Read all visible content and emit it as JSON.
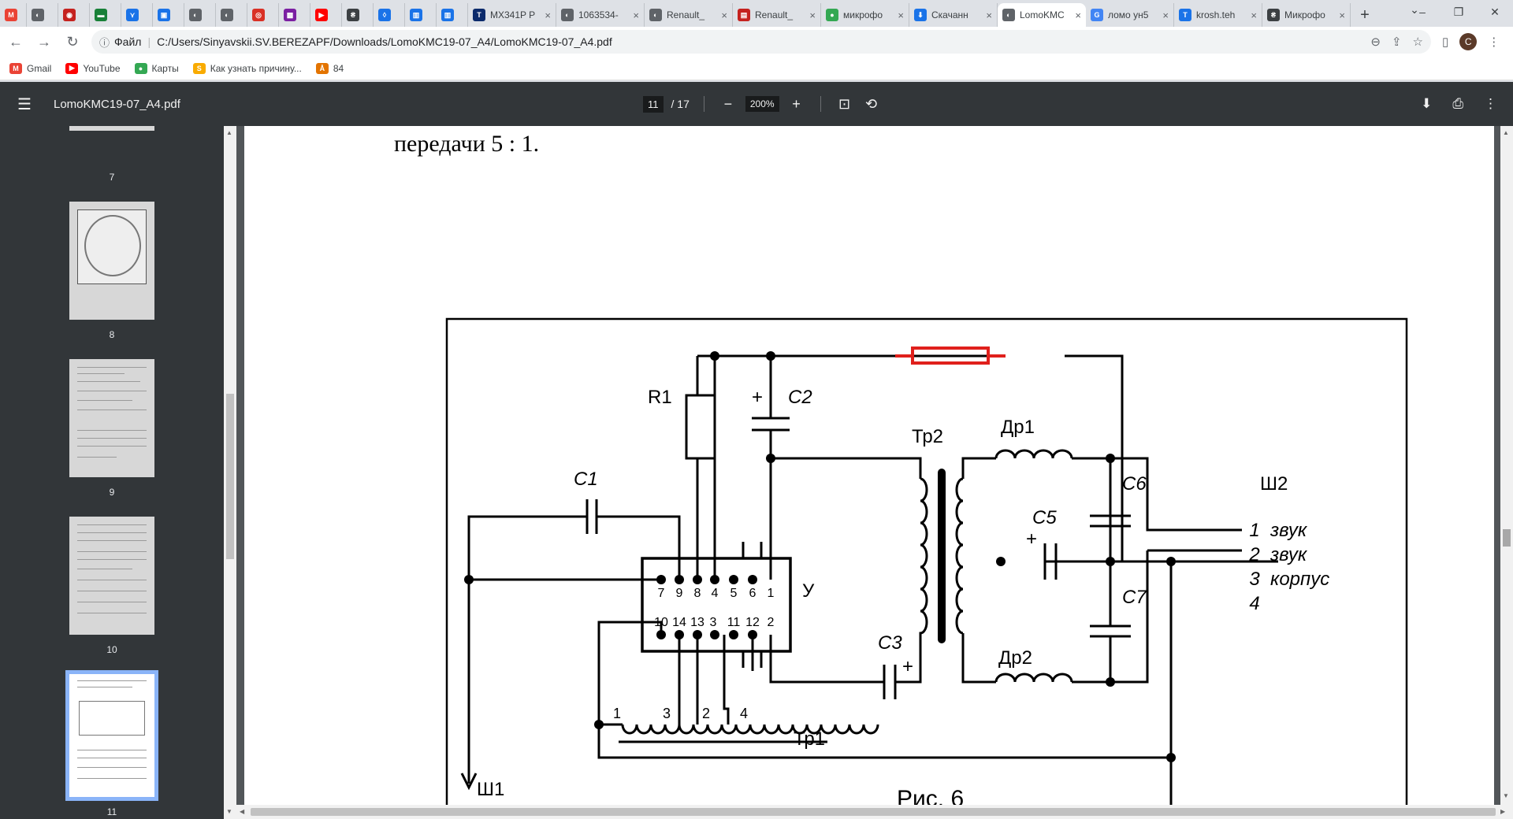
{
  "browser": {
    "tabs": [
      {
        "title": "",
        "color": "#ea4335",
        "glyph": "M"
      },
      {
        "title": "",
        "color": "#5f6368",
        "glyph": "◐"
      },
      {
        "title": "",
        "color": "#c5221f",
        "glyph": "◉"
      },
      {
        "title": "",
        "color": "#188038",
        "glyph": "▬"
      },
      {
        "title": "",
        "color": "#1a73e8",
        "glyph": "⋎"
      },
      {
        "title": "",
        "color": "#1a73e8",
        "glyph": "▣"
      },
      {
        "title": "",
        "color": "#5f6368",
        "glyph": "◐"
      },
      {
        "title": "",
        "color": "#5f6368",
        "glyph": "◐"
      },
      {
        "title": "",
        "color": "#d93025",
        "glyph": "◎"
      },
      {
        "title": "",
        "color": "#7b1fa2",
        "glyph": "▩"
      },
      {
        "title": "",
        "color": "#ff0000",
        "glyph": "▶"
      },
      {
        "title": "",
        "color": "#3c4043",
        "glyph": "₴"
      },
      {
        "title": "",
        "color": "#1a73e8",
        "glyph": "◊"
      },
      {
        "title": "",
        "color": "#1a73e8",
        "glyph": "▥"
      },
      {
        "title": "",
        "color": "#1a73e8",
        "glyph": "▥"
      },
      {
        "title": "MX341P P",
        "color": "#0b2a6b",
        "glyph": "T"
      },
      {
        "title": "1063534-",
        "color": "#5f6368",
        "glyph": "◐"
      },
      {
        "title": "Renault_",
        "color": "#5f6368",
        "glyph": "◐"
      },
      {
        "title": "Renault_",
        "color": "#c5221f",
        "glyph": "▤"
      },
      {
        "title": "микрофо",
        "color": "#34a853",
        "glyph": "●"
      },
      {
        "title": "Скачанн",
        "color": "#1a73e8",
        "glyph": "⬇"
      },
      {
        "title": "LomoKMC",
        "color": "#5f6368",
        "glyph": "◐",
        "active": true
      },
      {
        "title": "ломо ун5",
        "color": "#4285f4",
        "glyph": "G"
      },
      {
        "title": "krosh.teh",
        "color": "#1a73e8",
        "glyph": "T"
      },
      {
        "title": "Микрофо",
        "color": "#3c4043",
        "glyph": "₴"
      }
    ],
    "address": {
      "scheme_label": "Файл",
      "url": "C:/Users/Sinyavskii.SV.BEREZAPF/Downloads/LomoKMC19-07_A4/LomoKMC19-07_A4.pdf"
    },
    "avatar_letter": "С",
    "bookmarks": [
      {
        "label": "Gmail",
        "color": "#ea4335",
        "glyph": "M"
      },
      {
        "label": "YouTube",
        "color": "#ff0000",
        "glyph": "▶"
      },
      {
        "label": "Карты",
        "color": "#34a853",
        "glyph": "●"
      },
      {
        "label": "Как узнать причину...",
        "color": "#f9ab00",
        "glyph": "S"
      },
      {
        "label": "84",
        "color": "#e37400",
        "glyph": "Å"
      }
    ]
  },
  "pdf": {
    "file_name": "LomoKMC19-07_A4.pdf",
    "current_page": "11",
    "total_pages": "/ 17",
    "zoom": "200%",
    "thumbnails": [
      {
        "num": "7"
      },
      {
        "num": "8"
      },
      {
        "num": "9"
      },
      {
        "num": "10"
      },
      {
        "num": "11",
        "selected": true
      }
    ],
    "page_top_text": "передачи 5 : 1.",
    "caption": "Рис. 6"
  },
  "schematic": {
    "components": {
      "r1": "R1",
      "c1": "C1",
      "c2": "C2",
      "c3": "C3",
      "c5": "C5",
      "c6": "C6",
      "c7": "C7",
      "tr1": "Тр1",
      "tr2": "Тр2",
      "dr1": "Др1",
      "dr2": "Др2",
      "amp": "У",
      "sh1": "Ш1",
      "sh2": "Ш2",
      "plus": "+"
    },
    "ic_pins_top": [
      "7",
      "9",
      "8",
      "4",
      "5",
      "6",
      "1"
    ],
    "ic_pins_bottom": [
      "10",
      "14",
      "13",
      "3",
      "11",
      "12",
      "2"
    ],
    "tr1_pins": [
      "1",
      "3",
      "2",
      "4"
    ],
    "connector": [
      {
        "num": "1",
        "label": "звук"
      },
      {
        "num": "2",
        "label": "звук"
      },
      {
        "num": "3",
        "label": "корпус"
      },
      {
        "num": "4",
        "label": ""
      }
    ],
    "colors": {
      "fuse": "#e0201c",
      "wire": "#000000"
    }
  }
}
